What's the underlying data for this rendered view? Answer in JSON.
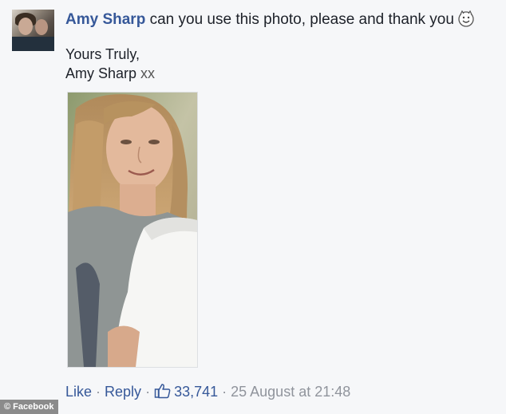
{
  "comment": {
    "author": "Amy Sharp",
    "text": " can you use this photo, please and thank you",
    "emoji": "smiling-emoticon",
    "signoff_line1": "Yours Truly,",
    "signoff_name": "Amy Sharp",
    "signoff_suffix": " xx"
  },
  "actions": {
    "like_label": "Like",
    "separator": "·",
    "reply_label": "Reply",
    "like_icon": "thumbs-up-icon",
    "like_count": "33,741",
    "timestamp": "25 August at 21:48"
  },
  "watermark": "© Facebook",
  "colors": {
    "link": "#365899",
    "meta": "#90949c",
    "text": "#1d2129",
    "background": "#f6f7f9"
  }
}
